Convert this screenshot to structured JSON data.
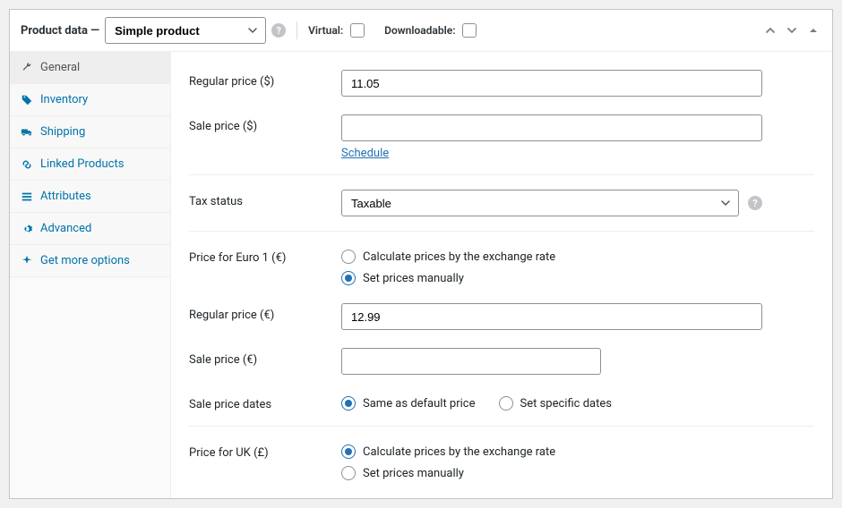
{
  "header": {
    "title": "Product data —",
    "product_type": "Simple product",
    "virtual_label": "Virtual:",
    "downloadable_label": "Downloadable:"
  },
  "sidebar": {
    "items": [
      {
        "label": "General",
        "active": true
      },
      {
        "label": "Inventory",
        "active": false
      },
      {
        "label": "Shipping",
        "active": false
      },
      {
        "label": "Linked Products",
        "active": false
      },
      {
        "label": "Attributes",
        "active": false
      },
      {
        "label": "Advanced",
        "active": false
      },
      {
        "label": "Get more options",
        "active": false
      }
    ]
  },
  "labels": {
    "regular_price_usd": "Regular price ($)",
    "sale_price_usd": "Sale price ($)",
    "schedule": "Schedule",
    "tax_status": "Tax status",
    "price_euro": "Price for Euro 1 (€)",
    "regular_price_eur": "Regular price (€)",
    "sale_price_eur": "Sale price (€)",
    "sale_price_dates": "Sale price dates",
    "price_uk": "Price for UK (£)"
  },
  "values": {
    "regular_price_usd": "11.05",
    "sale_price_usd": "",
    "tax_status": "Taxable",
    "regular_price_eur": "12.99",
    "sale_price_eur": ""
  },
  "radios": {
    "calc_exchange": "Calculate prices by the exchange rate",
    "set_manually": "Set prices manually",
    "same_default": "Same as default price",
    "set_specific": "Set specific dates"
  }
}
